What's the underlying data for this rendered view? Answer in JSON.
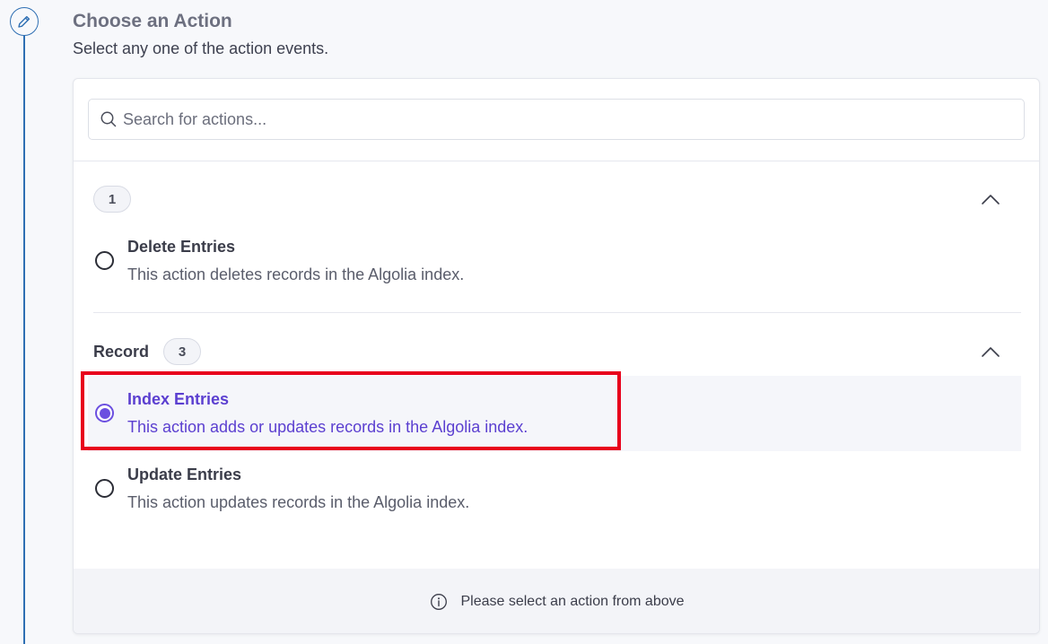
{
  "header": {
    "title": "Choose an Action",
    "subtitle": "Select any one of the action events."
  },
  "search": {
    "placeholder": "Search for actions...",
    "value": ""
  },
  "groups": [
    {
      "name": "",
      "count": "1",
      "expanded": true,
      "items": [
        {
          "title": "Delete Entries",
          "description": "This action deletes records in the Algolia index.",
          "selected": false
        }
      ]
    },
    {
      "name": "Record",
      "count": "3",
      "expanded": true,
      "items": [
        {
          "title": "Index Entries",
          "description": "This action adds or updates records in the Algolia index.",
          "selected": true
        },
        {
          "title": "Update Entries",
          "description": "This action updates records in the Algolia index.",
          "selected": false
        }
      ]
    }
  ],
  "footer": {
    "message": "Please select an action from above"
  },
  "colors": {
    "accent": "#6b4fe0",
    "step_line": "#2f6fb3",
    "highlight": "#e8001c"
  },
  "icons": {
    "step": "pencil-icon",
    "search": "search-icon",
    "collapse": "chevron-up-icon",
    "info": "info-icon"
  }
}
